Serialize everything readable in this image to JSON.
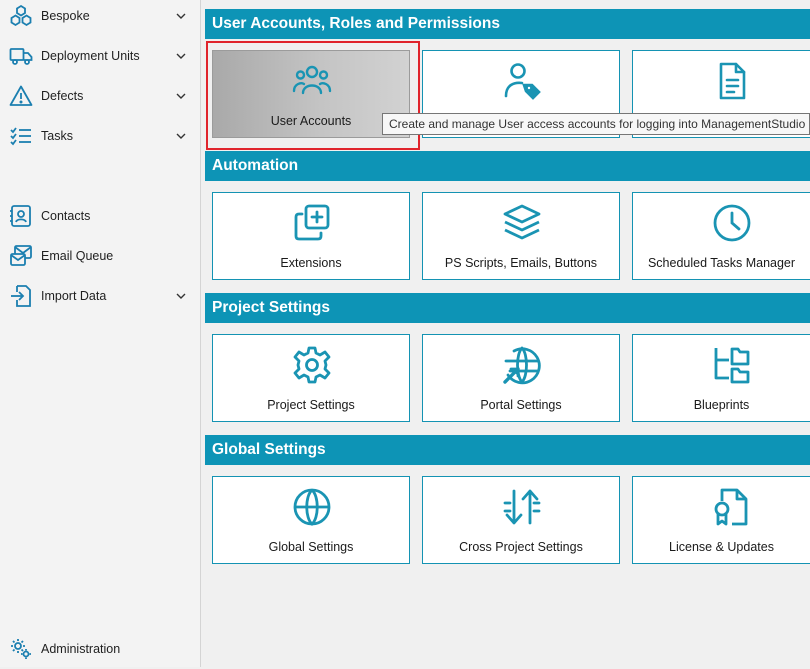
{
  "sidebar": {
    "items": [
      {
        "label": "Bespoke",
        "icon": "boxes-icon",
        "expandable": true
      },
      {
        "label": "Deployment Units",
        "icon": "truck-icon",
        "expandable": true
      },
      {
        "label": "Defects",
        "icon": "warning-icon",
        "expandable": true
      },
      {
        "label": "Tasks",
        "icon": "tasks-icon",
        "expandable": true
      },
      {
        "label": "Contacts",
        "icon": "contact-card-icon",
        "expandable": false
      },
      {
        "label": "Email Queue",
        "icon": "email-queue-icon",
        "expandable": false
      },
      {
        "label": "Import Data",
        "icon": "import-icon",
        "expandable": true
      }
    ],
    "footer": {
      "label": "Administration",
      "icon": "gears-icon"
    }
  },
  "sections": [
    {
      "title": "User Accounts, Roles and Permissions",
      "tiles": [
        {
          "label": "User Accounts",
          "icon": "users-icon"
        },
        {
          "label": "",
          "icon": "user-tag-icon"
        },
        {
          "label": "",
          "icon": "document-icon"
        }
      ]
    },
    {
      "title": "Automation",
      "tiles": [
        {
          "label": "Extensions",
          "icon": "add-copy-icon"
        },
        {
          "label": "PS Scripts, Emails, Buttons",
          "icon": "layers-icon"
        },
        {
          "label": "Scheduled Tasks Manager",
          "icon": "clock-icon"
        }
      ]
    },
    {
      "title": "Project Settings",
      "tiles": [
        {
          "label": "Project Settings",
          "icon": "gear-icon"
        },
        {
          "label": "Portal Settings",
          "icon": "globe-arrow-icon"
        },
        {
          "label": "Blueprints",
          "icon": "folder-tree-icon"
        }
      ]
    },
    {
      "title": "Global Settings",
      "tiles": [
        {
          "label": "Global Settings",
          "icon": "globe-icon"
        },
        {
          "label": "Cross Project Settings",
          "icon": "arrows-updown-icon"
        },
        {
          "label": "License & Updates",
          "icon": "license-certificate-icon"
        }
      ]
    }
  ],
  "tooltip": "Create and manage User access accounts for logging into ManagementStudio",
  "colors": {
    "accent": "#0d94b6",
    "icon": "#1a94b3",
    "highlight_border": "#e0242c",
    "sidebar_icon": "#1b7fb0"
  }
}
